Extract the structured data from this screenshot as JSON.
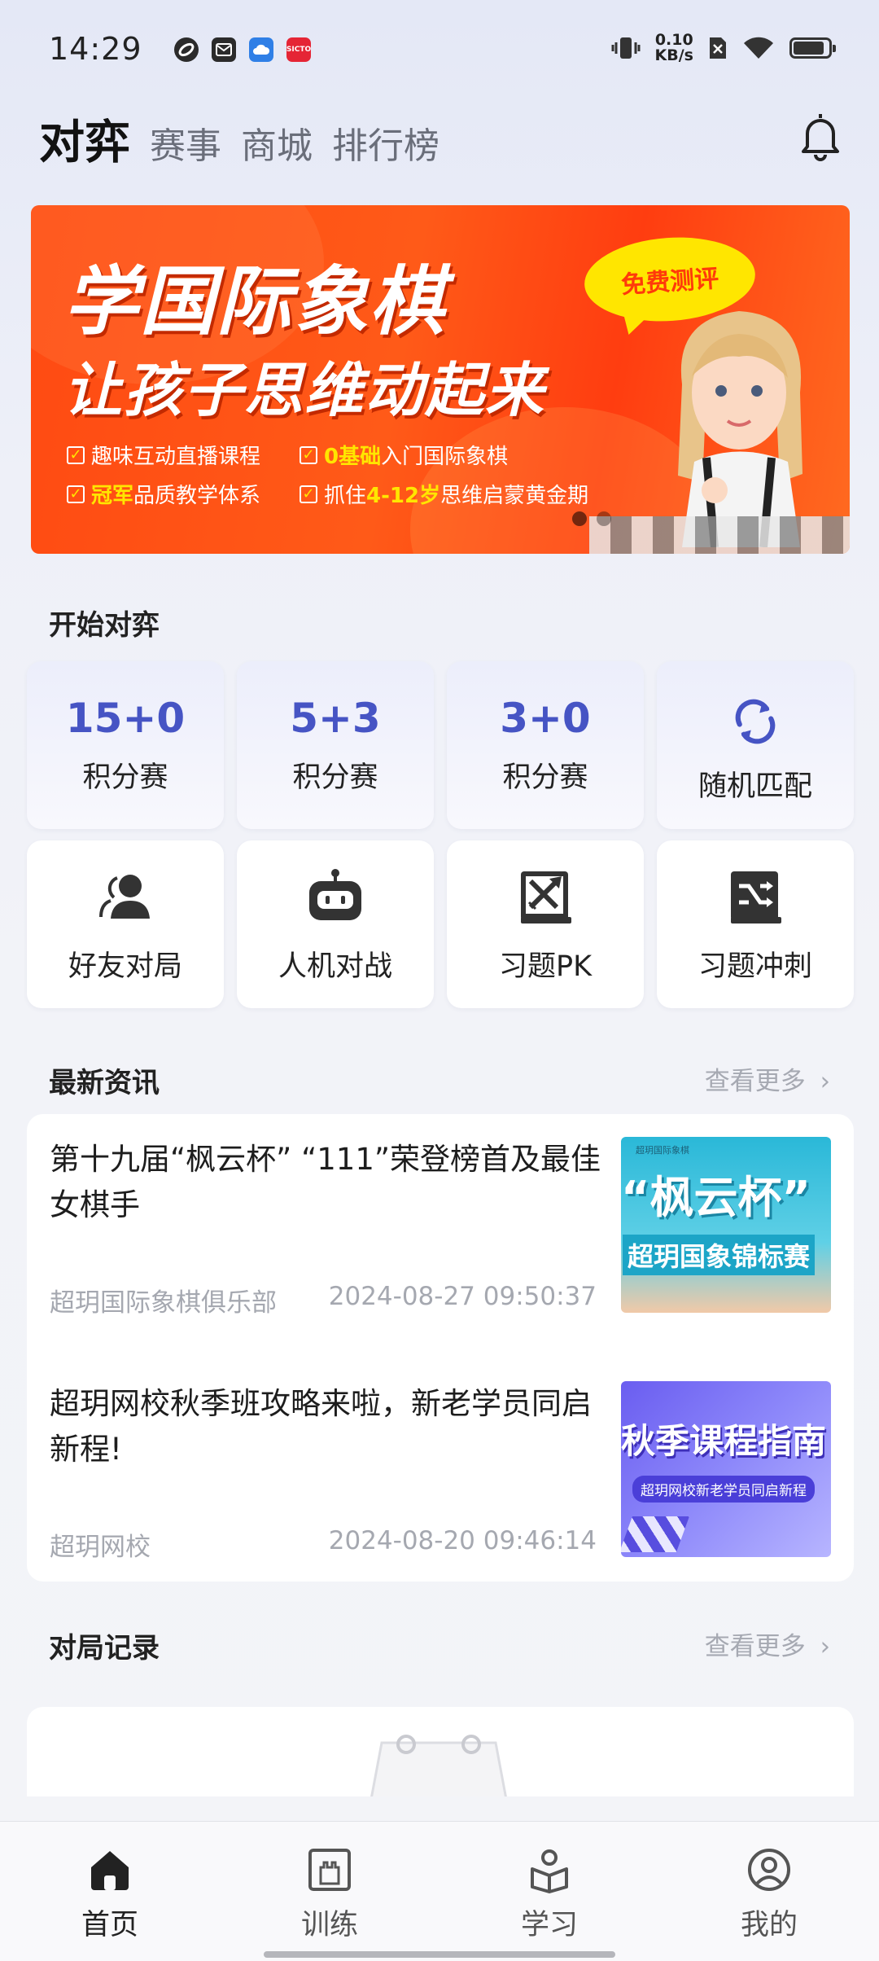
{
  "status_bar": {
    "time": "14:29",
    "network_speed_value": "0.10",
    "network_speed_unit": "KB/s",
    "app_icons": [
      "swirl-app-icon",
      "mail-app-icon",
      "cloud-app-icon",
      "red-app-icon"
    ],
    "red_app_text": "SICTO",
    "battery_level": 0.88
  },
  "header": {
    "tabs": [
      {
        "label": "对弈",
        "active": true
      },
      {
        "label": "赛事",
        "active": false
      },
      {
        "label": "商城",
        "active": false
      },
      {
        "label": "排行榜",
        "active": false
      }
    ]
  },
  "banner": {
    "title_line1": "学国际象棋",
    "title_line2": "让孩子思维动起来",
    "badge": "免费测评",
    "features": [
      {
        "pre": "",
        "highlight": "",
        "text": "趣味互动直播课程"
      },
      {
        "pre": "",
        "highlight": "0基础",
        "text": "入门国际象棋"
      },
      {
        "pre": "",
        "highlight": "冠军",
        "text": "品质教学体系"
      },
      {
        "pre": "抓住",
        "highlight": "4-12岁",
        "text": "思维启蒙黄金期"
      }
    ],
    "slide_count": 2,
    "active_slide": 0
  },
  "start_game": {
    "title": "开始对弈",
    "modes": [
      {
        "big": "15+0",
        "label": "积分赛"
      },
      {
        "big": "5+3",
        "label": "积分赛"
      },
      {
        "big": "3+0",
        "label": "积分赛"
      },
      {
        "icon": "refresh-icon",
        "label": "随机匹配"
      },
      {
        "icon": "friends-icon",
        "label": "好友对局"
      },
      {
        "icon": "robot-icon",
        "label": "人机对战"
      },
      {
        "icon": "puzzle-pk-icon",
        "label": "习题PK"
      },
      {
        "icon": "puzzle-rush-icon",
        "label": "习题冲刺"
      }
    ]
  },
  "news": {
    "title": "最新资讯",
    "see_more": "查看更多",
    "items": [
      {
        "title": "第十九届“枫云杯” “111”荣登榜首及最佳女棋手",
        "source": "超玥国际象棋俱乐部",
        "date": "2024-08-27 09:50:37",
        "thumb_text": "“枫云杯”",
        "thumb_sub": "超玥国象锦标赛",
        "thumb_tag": "超玥国际象棋"
      },
      {
        "title": "超玥网校秋季班攻略来啦，新老学员同启新程!",
        "source": "超玥网校",
        "date": "2024-08-20 09:46:14",
        "thumb_text": "秋季课程指南",
        "thumb_sub": "超玥网校新老学员同启新程"
      }
    ]
  },
  "records": {
    "title": "对局记录",
    "see_more": "查看更多"
  },
  "bottom_nav": [
    {
      "label": "首页",
      "icon": "home-icon",
      "active": true
    },
    {
      "label": "训练",
      "icon": "training-icon",
      "active": false
    },
    {
      "label": "学习",
      "icon": "learn-icon",
      "active": false
    },
    {
      "label": "我的",
      "icon": "profile-icon",
      "active": false
    }
  ],
  "colors": {
    "accent": "#4654c4",
    "banner_orange": "#ff4a12",
    "highlight_yellow": "#ffe600",
    "muted_text": "#a5a8b0"
  }
}
